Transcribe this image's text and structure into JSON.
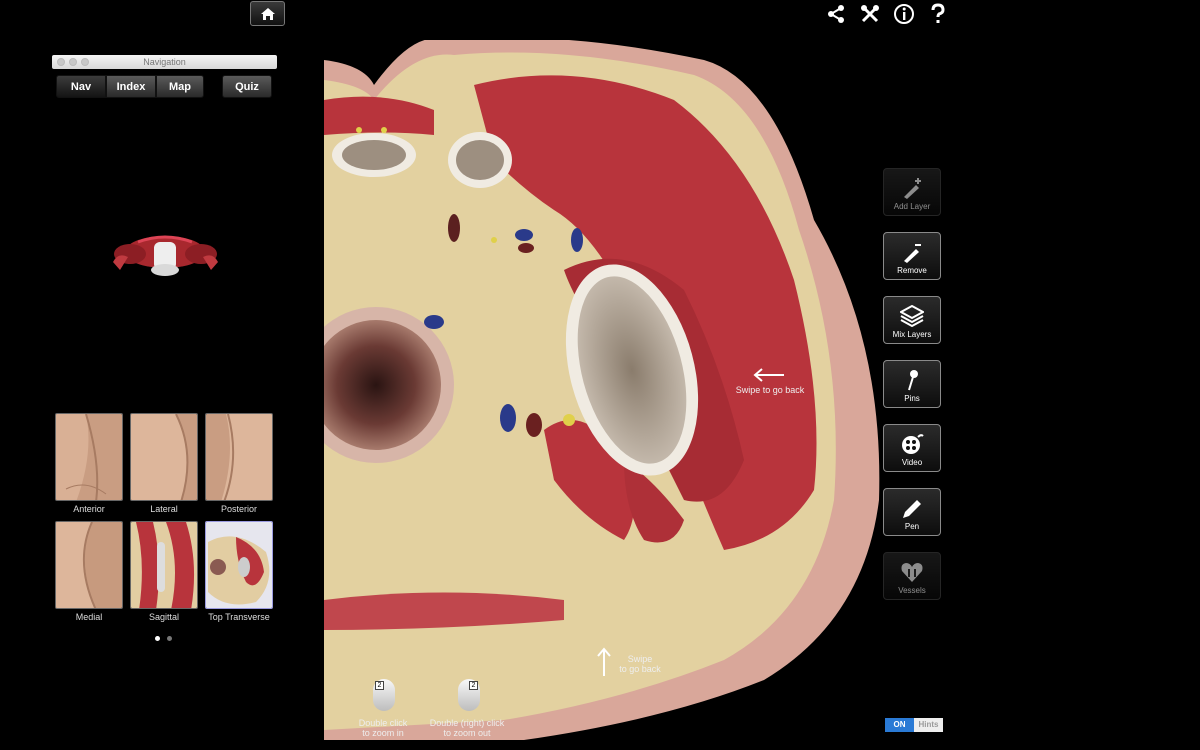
{
  "navigation": {
    "window_title": "Navigation",
    "tabs": [
      "Nav",
      "Index",
      "Map"
    ],
    "quiz_label": "Quiz"
  },
  "views": [
    {
      "label": "Anterior"
    },
    {
      "label": "Lateral"
    },
    {
      "label": "Posterior"
    },
    {
      "label": "Medial"
    },
    {
      "label": "Sagittal"
    },
    {
      "label": "Top Transverse"
    }
  ],
  "tools": [
    {
      "label": "Add Layer",
      "icon": "add-layer-icon",
      "enabled": false
    },
    {
      "label": "Remove",
      "icon": "remove-icon",
      "enabled": true
    },
    {
      "label": "Mix Layers",
      "icon": "layers-icon",
      "enabled": true
    },
    {
      "label": "Pins",
      "icon": "pin-icon",
      "enabled": true
    },
    {
      "label": "Video",
      "icon": "video-icon",
      "enabled": true
    },
    {
      "label": "Pen",
      "icon": "pen-icon",
      "enabled": true
    },
    {
      "label": "Vessels",
      "icon": "vessels-icon",
      "enabled": false
    }
  ],
  "hints": {
    "swipe_back_right": "Swipe to go back",
    "swipe_back_up_line1": "Swipe",
    "swipe_back_up_line2": "to go back",
    "zoom_in_line1": "Double click",
    "zoom_in_line2": "to zoom in",
    "zoom_out_line1": "Double (right) click",
    "zoom_out_line2": "to zoom out",
    "mouse_number": "2"
  },
  "hints_toggle": {
    "on": "ON",
    "label": "Hints"
  },
  "colors": {
    "accent": "#2a7ad5",
    "muscle": "#b8343c",
    "fat": "#e5d3a0"
  }
}
